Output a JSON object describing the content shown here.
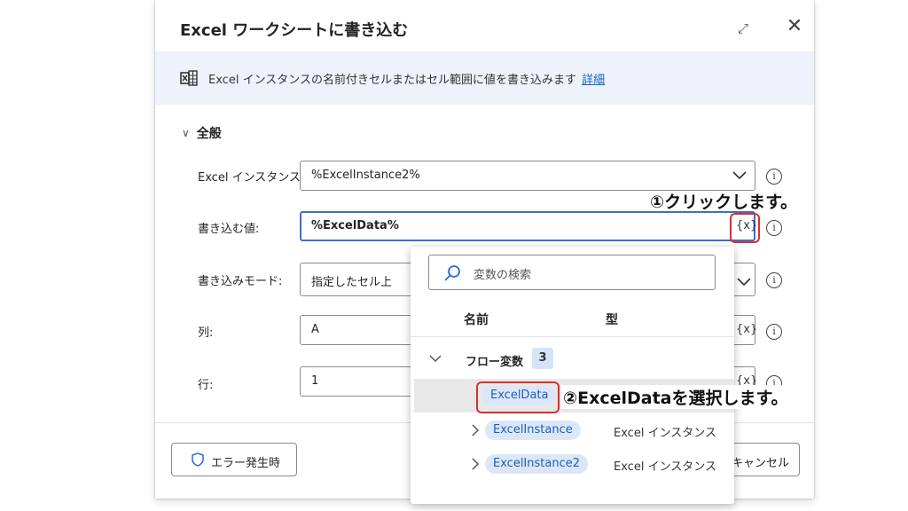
{
  "dialog": {
    "title": "Excel ワークシートに書き込む",
    "expand_icon": "⤢",
    "close_icon": "✕",
    "info": {
      "text": "Excel インスタンスの名前付きセルまたはセル範囲に値を書き込みます",
      "link": "詳細"
    },
    "section": {
      "chevron": "∨",
      "title": "全般"
    },
    "fields": {
      "instance": {
        "label": "Excel インスタンス:",
        "value": "%ExcelInstance2%"
      },
      "value": {
        "label": "書き込む値:",
        "value": "%ExcelData%"
      },
      "mode": {
        "label": "書き込みモード:",
        "value": "指定したセル上"
      },
      "column": {
        "label": "列:",
        "value": "A"
      },
      "row": {
        "label": "行:",
        "value": "1"
      }
    },
    "var_button": "{x}",
    "info_icon": "i",
    "buttons": {
      "on_error": "エラー発生時",
      "cancel": "キャンセル"
    }
  },
  "popup": {
    "search_placeholder": "変数の検索",
    "columns": {
      "name": "名前",
      "type": "型"
    },
    "group": {
      "label": "フロー変数",
      "count": "3"
    },
    "items": [
      {
        "name": "ExcelData",
        "type": "",
        "selected": true
      },
      {
        "name": "ExcelInstance",
        "type": "Excel インスタンス",
        "selected": false
      },
      {
        "name": "ExcelInstance2",
        "type": "Excel インスタンス",
        "selected": false
      }
    ]
  },
  "annotations": {
    "step1": "①クリックします。",
    "step2": "②ExcelDataを選択します。"
  },
  "colors": {
    "accent": "#3b6fd1",
    "highlight_red": "#d92f2f",
    "pill_bg": "#dbe7f8",
    "pill_text": "#1d5fb8"
  }
}
